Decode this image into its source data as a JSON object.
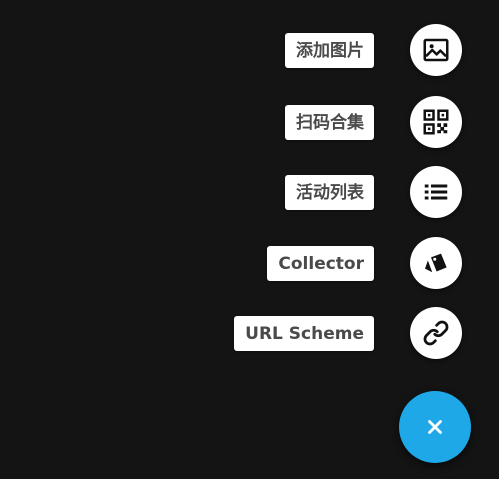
{
  "speed_dial": {
    "actions": [
      {
        "label": "添加图片",
        "icon": "image-icon"
      },
      {
        "label": "扫码合集",
        "icon": "qr-code-icon"
      },
      {
        "label": "活动列表",
        "icon": "list-icon"
      },
      {
        "label": "Collector",
        "icon": "tag-icon"
      },
      {
        "label": "URL Scheme",
        "icon": "link-icon"
      }
    ],
    "main_fab": {
      "icon": "close-icon",
      "color": "#1ea8e8"
    }
  },
  "colors": {
    "background": "#141414",
    "label_background": "#ffffff",
    "label_text": "#4a4a4a"
  }
}
